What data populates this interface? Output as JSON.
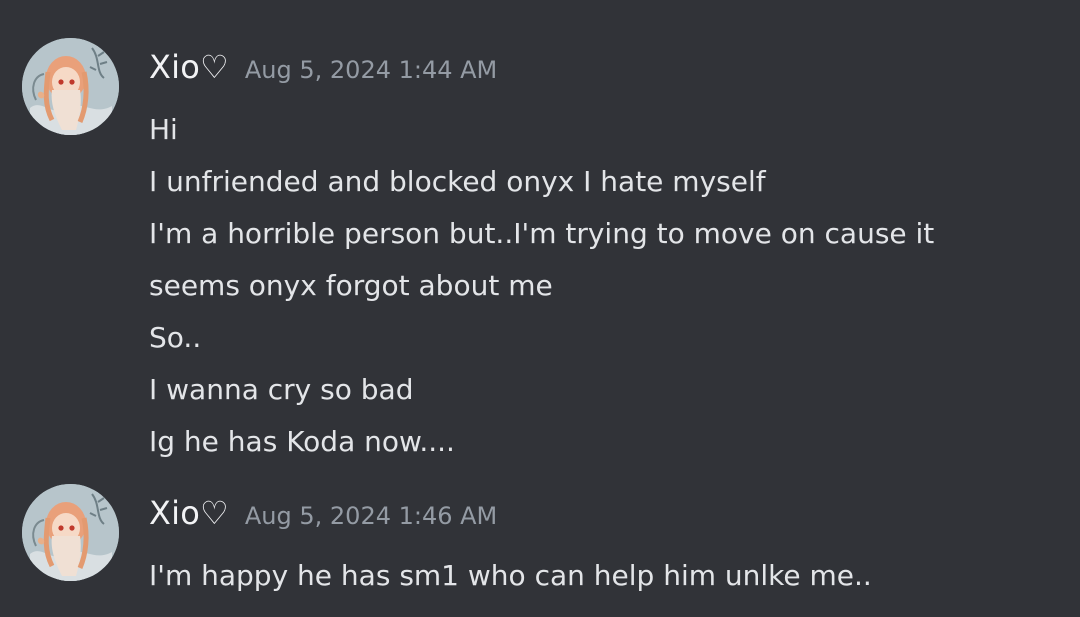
{
  "messages": [
    {
      "author": "Xio♡",
      "timestamp": "Aug 5, 2024 1:44 AM",
      "avatar_icon": "anime-avatar",
      "lines": [
        "Hi",
        "I unfriended and blocked onyx I hate myself",
        "I'm a horrible person but..I'm trying to move on cause it",
        "seems onyx forgot about me",
        "So..",
        "I wanna cry so bad",
        "Ig he has Koda now...."
      ]
    },
    {
      "author": "Xio♡",
      "timestamp": "Aug 5, 2024 1:46 AM",
      "avatar_icon": "anime-avatar",
      "lines": [
        "I'm happy he has sm1 who can help him unlke me.."
      ]
    }
  ],
  "colors": {
    "background": "#313338",
    "username": "#f2f3f5",
    "timestamp": "#949ba4",
    "message_text": "#e3e5e8"
  }
}
